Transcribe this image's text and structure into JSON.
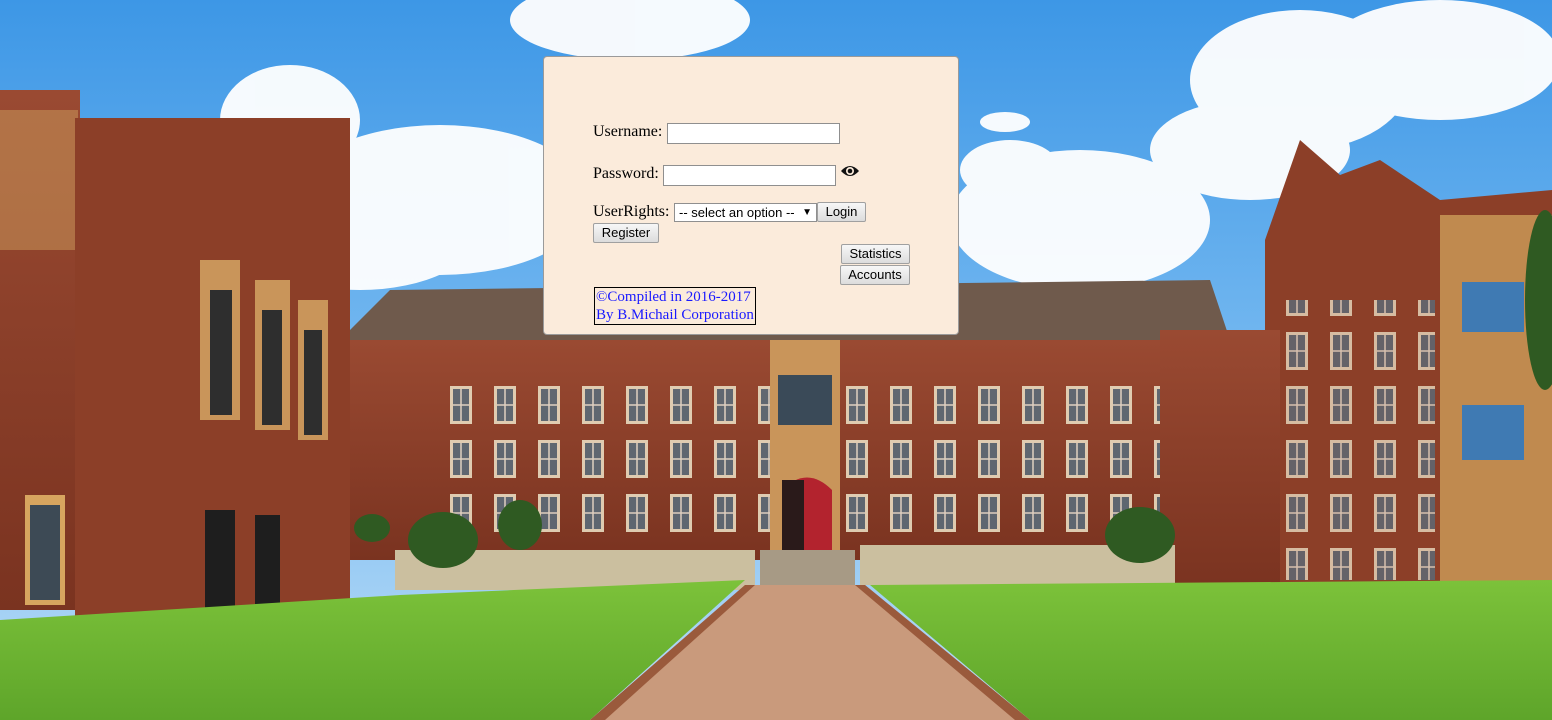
{
  "login": {
    "username_label": "Username:",
    "username_value": "",
    "password_label": "Password:",
    "password_value": "",
    "show_password_icon": "eye-icon",
    "userrights_label": "UserRights:",
    "userrights_selected": "-- select an option --",
    "login_label": "Login",
    "register_label": "Register",
    "statistics_label": "Statistics",
    "accounts_label": "Accounts"
  },
  "copyright": {
    "line1": "©Compiled in 2016-2017",
    "line2": "By B.Michail Corporation"
  },
  "colors": {
    "panel_background": "#fbebdb",
    "copyright_text": "#1a1aff"
  },
  "background": {
    "description_icon": "university-building-photo"
  }
}
